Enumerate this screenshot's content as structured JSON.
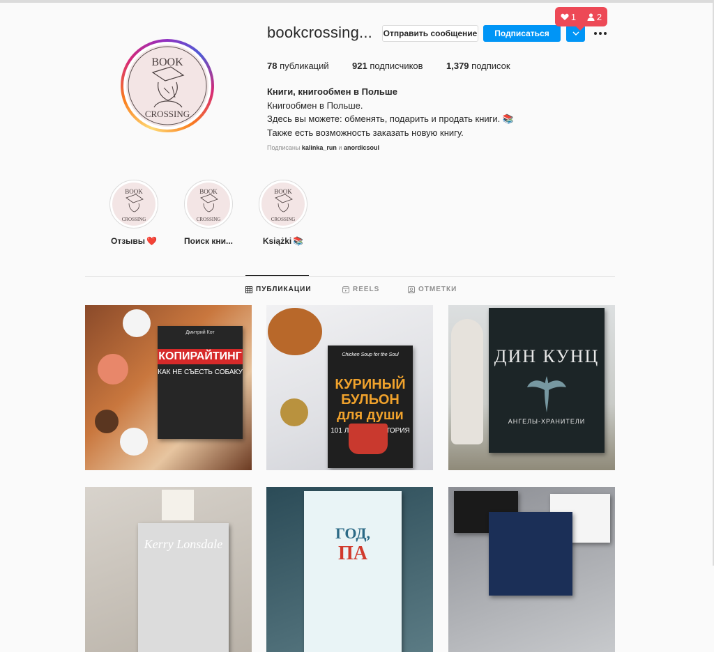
{
  "profile": {
    "username": "bookcrossing...",
    "actions": {
      "message": "Отправить сообщение",
      "follow": "Подписаться",
      "dropdown_icon": "chevron-down-icon"
    },
    "notification": {
      "likes": "1",
      "followers": "2",
      "color": "#ed4956"
    },
    "stats": [
      {
        "value": "78",
        "label": " публикаций"
      },
      {
        "value": "921",
        "label": " подписчиков"
      },
      {
        "value": "1,379",
        "label": " подписок"
      }
    ],
    "bio": {
      "name": "Книги, книгообмен в Польше",
      "lines": [
        "Книгообмен в Польше.",
        "Здесь вы можете: обменять, подарить и продать книги. 📚",
        "Также есть возможность заказать новую книгу."
      ]
    },
    "followed_by": {
      "prefix": "Подписаны ",
      "user1": "kalinka_run",
      "sep": " и ",
      "user2": "anordicsoul"
    },
    "logo": {
      "top": "BOOK",
      "bottom": "CROSSING"
    }
  },
  "highlights": [
    {
      "label": "Отзывы",
      "emoji": "❤️"
    },
    {
      "label": "Поиск кни...",
      "emoji": ""
    },
    {
      "label": "Książki",
      "emoji": "📚"
    }
  ],
  "tabs": [
    {
      "label": "ПУБЛИКАЦИИ",
      "icon": "grid-icon",
      "active": true
    },
    {
      "label": "REELS",
      "icon": "reels-icon",
      "active": false
    },
    {
      "label": "ОТМЕТКИ",
      "icon": "tagged-icon",
      "active": false
    }
  ],
  "posts": [
    {
      "book_title": "КОПИРАЙТИНГ",
      "book_subtitle": "КАК НЕ СЪЕСТЬ СОБАКУ",
      "author": "Дмитрий Кот"
    },
    {
      "book_title": "КУРИНЫЙ БУЛЬОН для души",
      "book_subtitle": "101 ЛУЧШАЯ ИСТОРИЯ",
      "author": "Chicken Soup for the Soul"
    },
    {
      "book_title": "ДИН КУНЦ",
      "book_subtitle": "АНГЕЛЫ-ХРАНИТЕЛИ",
      "author": ""
    },
    {
      "book_title": "Kerry Lonsdale",
      "book_subtitle": "",
      "author": ""
    },
    {
      "book_title": "ГОД,",
      "book_subtitle": "ПА",
      "author": ""
    },
    {
      "book_title": "",
      "book_subtitle": "",
      "author": ""
    }
  ],
  "colors": {
    "accent": "#0095f6",
    "text": "#262626",
    "muted": "#8e8e8e",
    "border": "#dbdbdb"
  }
}
